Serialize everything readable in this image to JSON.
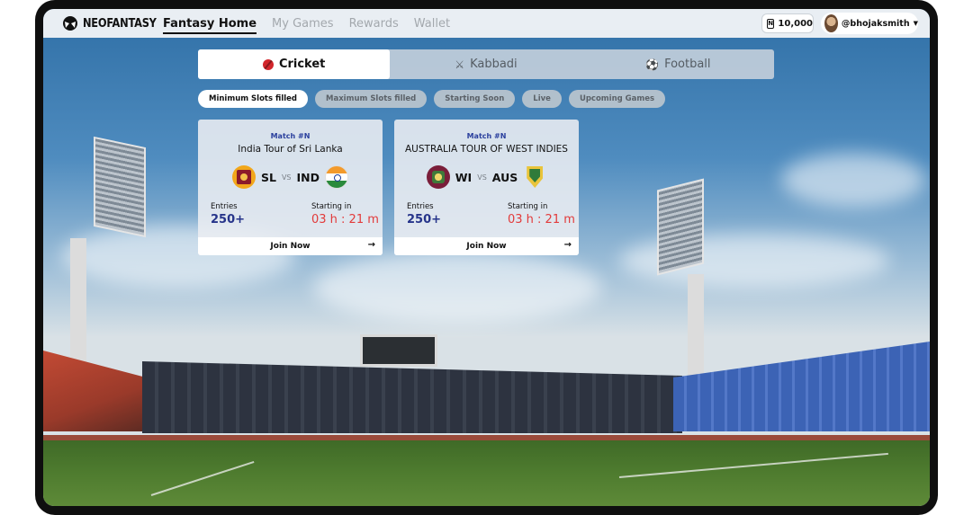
{
  "header": {
    "brand": "NEOFANTASY",
    "nav": [
      "Fantasy Home",
      "My Games",
      "Rewards",
      "Wallet"
    ],
    "balance": "10,000",
    "username": "@bhojaksmith"
  },
  "sports": [
    {
      "label": "Cricket",
      "icon": "cricket-ball-icon"
    },
    {
      "label": "Kabbadi",
      "icon": "kabaddi-player-icon"
    },
    {
      "label": "Football",
      "icon": "football-icon"
    }
  ],
  "filters": [
    "Minimum Slots filled",
    "Maximum Slots filled",
    "Starting Soon",
    "Live",
    "Upcoming Games"
  ],
  "matches": [
    {
      "tag": "Match #N",
      "title": "India Tour of Sri Lanka",
      "team1": "SL",
      "team2": "IND",
      "vs": "VS",
      "entries_label": "Entries",
      "entries": "250+",
      "start_label": "Starting in",
      "start": "03 h :  21 m",
      "cta": "Join Now"
    },
    {
      "tag": "Match #N",
      "title": "AUSTRALIA TOUR OF WEST INDIES",
      "team1": "WI",
      "team2": "AUS",
      "vs": "VS",
      "entries_label": "Entries",
      "entries": "250+",
      "start_label": "Starting in",
      "start": "03 h :  21 m",
      "cta": "Join Now"
    }
  ],
  "colors": {
    "accent_navy": "#26348a",
    "timer_red": "#e23a3a",
    "cricket_red": "#d2262b"
  }
}
